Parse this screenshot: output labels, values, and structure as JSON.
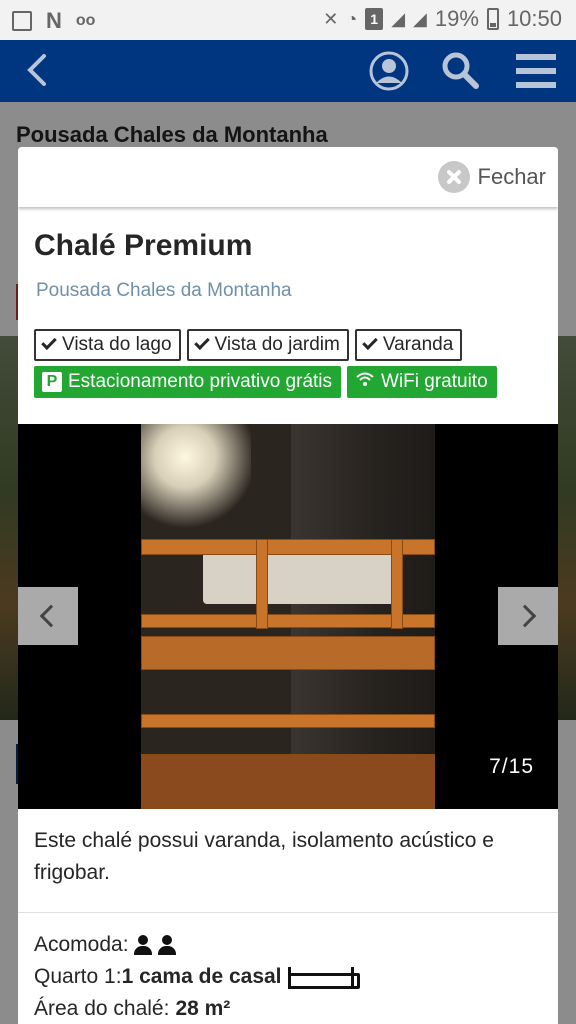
{
  "status_bar": {
    "battery": "19%",
    "time": "10:50",
    "sim_slot": "1",
    "notification_n": "N"
  },
  "app_bar": {
    "icons": [
      "back-arrow-icon",
      "profile-icon",
      "search-icon",
      "menu-icon"
    ]
  },
  "background_page": {
    "hotel_title": "Pousada Chales da Montanha"
  },
  "modal": {
    "close_label": "Fechar",
    "room_title": "Chalé Premium",
    "hotel_name": "Pousada Chales da Montanha",
    "facilities": [
      "Vista do lago",
      "Vista do jardim",
      "Varanda"
    ],
    "green_facilities": [
      "Estacionamento privativo grátis",
      "WiFi gratuito"
    ],
    "gallery_counter": "7/15",
    "description": "Este chalé possui varanda, isolamento acústico e frigobar.",
    "details": {
      "accommodates_label": "Acomoda:",
      "room_label": "Quarto 1:",
      "room_bed": "1 cama de casal",
      "area_label": "Área do chalé:",
      "area_value": "28 m²"
    }
  },
  "colors": {
    "app_bar": "#003580",
    "green_tag": "#23a733",
    "link": "#7090a8"
  }
}
